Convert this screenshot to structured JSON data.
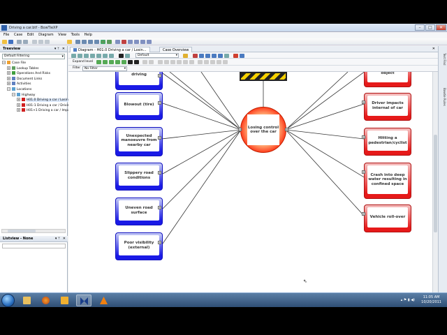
{
  "window": {
    "title": "Driving a car.btf - BowTieXP",
    "minimize": "–",
    "maximize": "□",
    "close": "✕"
  },
  "menu": [
    "File",
    "Case",
    "Edit",
    "Diagram",
    "View",
    "Tools",
    "Help"
  ],
  "treeview": {
    "header": "Treeview",
    "pin": "▾ ᛘ",
    "close": "✕",
    "filter": "Default Filtering",
    "nodes": [
      {
        "label": "Case File",
        "expander": "−",
        "color": "#f0a030"
      },
      {
        "label": "Lookup Tables",
        "expander": "+",
        "color": "#60a060"
      },
      {
        "label": "Operations And Risks",
        "expander": "+",
        "color": "#40a040"
      },
      {
        "label": "Document Links",
        "expander": "+",
        "color": "#6080c0"
      },
      {
        "label": "Activities",
        "expander": "+",
        "color": "#6080c0"
      },
      {
        "label": "Locations",
        "expander": "−",
        "color": "#5aa0d0"
      },
      {
        "label": "Highway",
        "expander": "−",
        "color": "#5aa0d0"
      },
      {
        "label": "H01.0 Driving a car / Losin",
        "expander": "+",
        "color": "#d02020"
      },
      {
        "label": "H01-1 Driving a car / Drivin",
        "expander": "+",
        "color": "#d02020"
      },
      {
        "label": "H01+1 Driving a car / Impa",
        "expander": "+",
        "color": "#d02020"
      }
    ]
  },
  "listview": {
    "header": "Listview - None",
    "pin": "▾ ᛘ",
    "close": "✕"
  },
  "tabs": {
    "diagram": "Diagram - H01.0 Driving a car / Losin...",
    "overview": "Case Overview",
    "close": "✕"
  },
  "toolbar": {
    "layout_select": "Default"
  },
  "expand_bar": {
    "label": "Expand level"
  },
  "filter_bar": {
    "label": "Filter",
    "value": "No Filter"
  },
  "diagram": {
    "top_event": "Losing control over the car",
    "threats": [
      "driving",
      "Blowout (tire)",
      "Unexpected manoeuvre from nearby car",
      "Slippery road conditions",
      "Uneven road surface",
      "Poor visibility (external)"
    ],
    "consequences": [
      "object",
      "Driver impacts internal of car",
      "Hitting a pedestrian/cyclist",
      "Crash into deep water resulting in confined space",
      "Vehicle roll-over"
    ],
    "connector_symbol": "+"
  },
  "right_sidebar": {
    "tabs": [
      "Text Find",
      "Bowtie Rules"
    ]
  },
  "taskbar": {
    "time": "11:05 AM",
    "date": "10/20/2011"
  },
  "colors": {
    "threat_fill": "#1a1ae6",
    "consequence_fill": "#e61a1a",
    "top_event": "#ff3a1a",
    "hazard_yellow": "#f5d000"
  }
}
